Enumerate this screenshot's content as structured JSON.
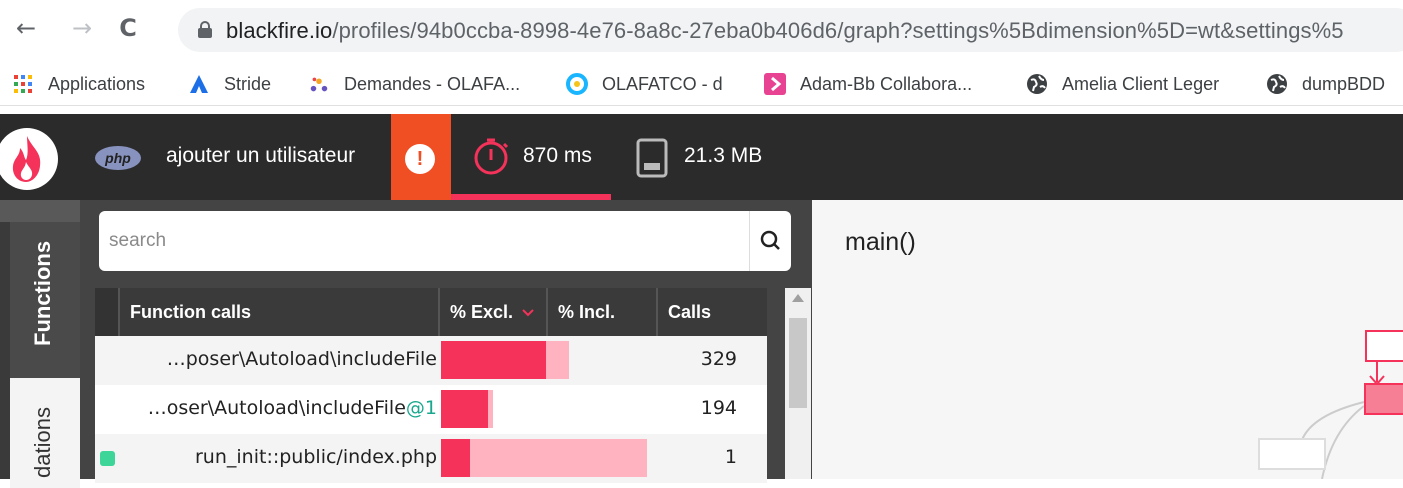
{
  "browser": {
    "nav": {
      "back": "←",
      "forward": "→",
      "reload": "C"
    },
    "url_host": "blackfire.io",
    "url_path": "/profiles/94b0ccba-8998-4e76-8a8c-27eba0b406d6/graph?settings%5Bdimension%5D=wt&settings%5",
    "bookmarks": [
      {
        "label": "Applications",
        "icon": "apps-grid-icon"
      },
      {
        "label": "Stride",
        "icon": "stride-icon"
      },
      {
        "label": "Demandes - OLAFA...",
        "icon": "jira-icon"
      },
      {
        "label": "OLAFATCO - d",
        "icon": "circle-target-icon"
      },
      {
        "label": "Adam-Bb Collabora...",
        "icon": "pink-chevron-icon"
      },
      {
        "label": "Amelia Client Leger",
        "icon": "globe-icon"
      },
      {
        "label": "dumpBDD",
        "icon": "globe-icon"
      }
    ]
  },
  "header": {
    "php_badge": "php",
    "title": "ajouter un utilisateur",
    "time": "870 ms",
    "memory": "21.3 MB",
    "colors": {
      "accent": "#f4325a",
      "alert": "#f04e23",
      "bg": "#2b2b2b"
    }
  },
  "tabs": {
    "functions": "Functions",
    "recommendations": "dations"
  },
  "search": {
    "placeholder": "search"
  },
  "table": {
    "headers": {
      "name": "Function calls",
      "excl": "% Excl.",
      "incl": "% Incl.",
      "calls": "Calls"
    },
    "rows": [
      {
        "name": "…poser\\Autoload\\includeFile",
        "suffix": "",
        "excl": 0.51,
        "incl": 0.62,
        "calls": "329",
        "marker": ""
      },
      {
        "name": "…oser\\Autoload\\includeFile",
        "suffix": "@1",
        "excl": 0.23,
        "incl": 0.25,
        "calls": "194",
        "marker": ""
      },
      {
        "name": "run_init::public/index.php",
        "suffix": "",
        "excl": 0.14,
        "incl": 1.0,
        "calls": "1",
        "marker": "#3dd598"
      }
    ]
  },
  "graph": {
    "title": "main()"
  }
}
